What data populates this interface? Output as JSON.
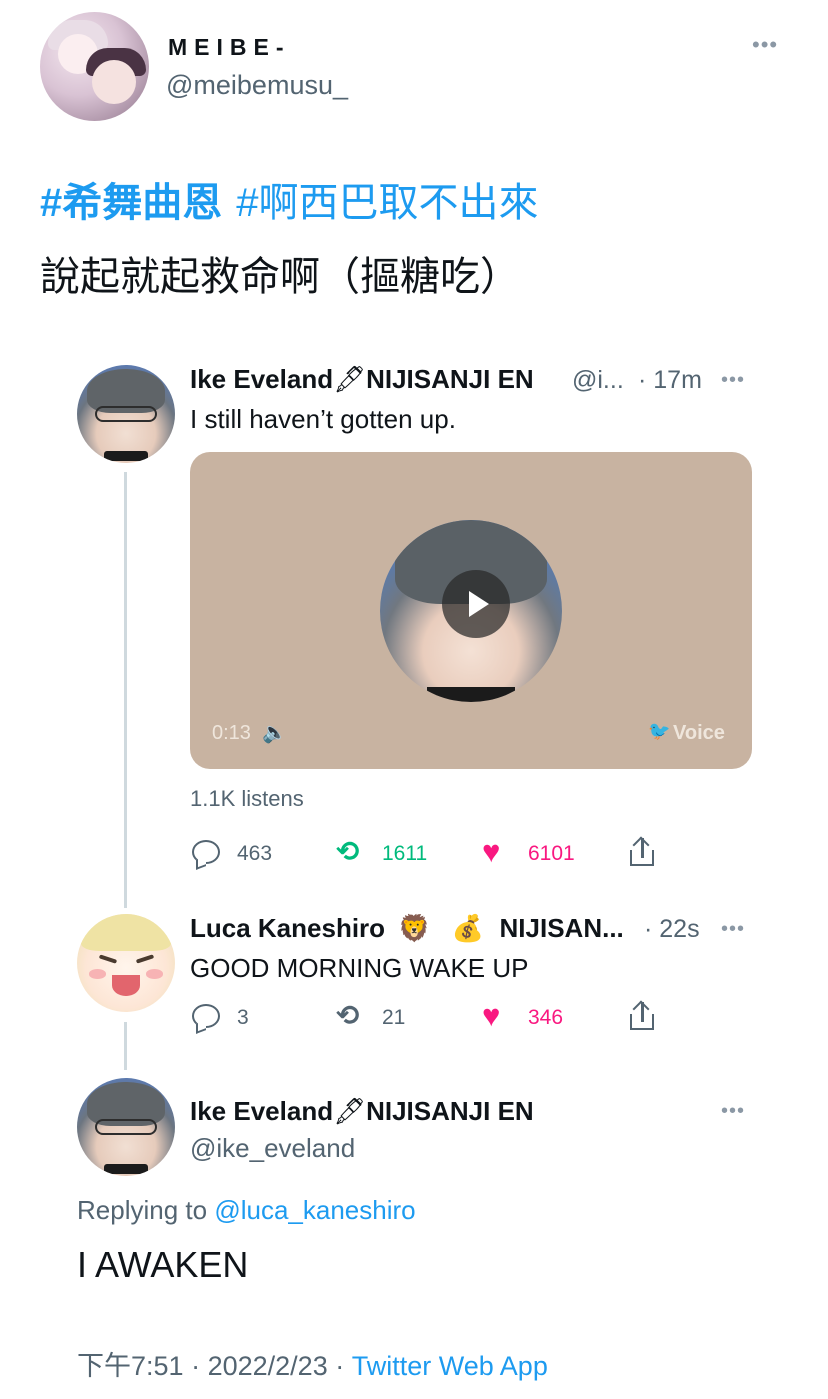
{
  "main_tweet": {
    "author_name": "MEIBE-",
    "author_handle": "@meibemusu_",
    "more_icon": "more-horizontal-icon",
    "hashtag_1": "#希舞曲恩",
    "hashtag_2": "#啊西巴取不出來",
    "text": "說起就起救命啊（摳糖吃）",
    "time": "下午7:51",
    "date": "2022/2/23",
    "separator": "·",
    "source_app": "Twitter Web App"
  },
  "thread": [
    {
      "name": "Ike Eveland",
      "emoji": "🖋",
      "org": "NIJISANJI EN",
      "handle": "@i...",
      "time": "· 17m",
      "text": "I still haven’t gotten up.",
      "media": {
        "duration": "0:13",
        "volume_icon": "volume-icon",
        "brand_icon": "twitter-bird-icon",
        "brand_label": "Voice",
        "play_icon": "play-icon"
      },
      "listens": "1.1K listens",
      "stats": {
        "replies": "463",
        "retweets": "1611",
        "likes": "6101"
      }
    },
    {
      "name": "Luca Kaneshiro",
      "emoji_1": "🦁",
      "emoji_2": "💰",
      "org": "NIJISAN...",
      "time": "· 22s",
      "text": "GOOD MORNING WAKE UP",
      "stats": {
        "replies": "3",
        "retweets": "21",
        "likes": "346"
      }
    }
  ],
  "focused_reply": {
    "name": "Ike Eveland",
    "emoji": "🖋",
    "org": "NIJISANJI EN",
    "handle": "@ike_eveland",
    "replying_prefix": "Replying to",
    "replying_to": "@luca_kaneshiro",
    "text": "I AWAKEN"
  },
  "icons": {
    "reply": "reply-icon",
    "retweet": "retweet-icon",
    "like": "heart-icon",
    "share": "share-icon"
  },
  "colors": {
    "link_blue": "#1d9bf0",
    "retweet_green": "#00ba7c",
    "like_pink": "#f91880",
    "secondary_text": "#536471",
    "media_background": "#c8b3a1"
  },
  "glyphs": {
    "more": "•••",
    "retweet": "⟲",
    "heart": "♥",
    "volume": "🔈",
    "bird": "🐦"
  }
}
